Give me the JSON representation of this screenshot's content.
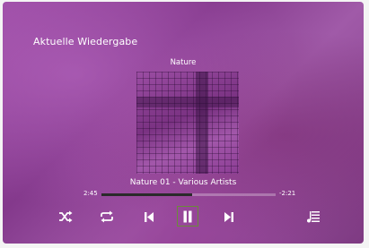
{
  "window": {
    "title": "Aktuelle Wiedergabe"
  },
  "album": {
    "name": "Nature"
  },
  "track": {
    "label": "Nature 01 - Various Artists"
  },
  "progress": {
    "elapsed": "2:45",
    "remaining": "-2:21",
    "fraction": 0.52
  },
  "controls": {
    "shuffle_icon": "shuffle-icon",
    "repeat_icon": "repeat-icon",
    "previous_icon": "skip-previous-icon",
    "pause_icon": "pause-icon",
    "next_icon": "skip-next-icon",
    "queue_icon": "playlist-icon"
  },
  "colors": {
    "background": "#8e4495",
    "text": "#ffffff",
    "progress_fill": "#2a2a2a",
    "focus_border": "#6b8a3a"
  }
}
